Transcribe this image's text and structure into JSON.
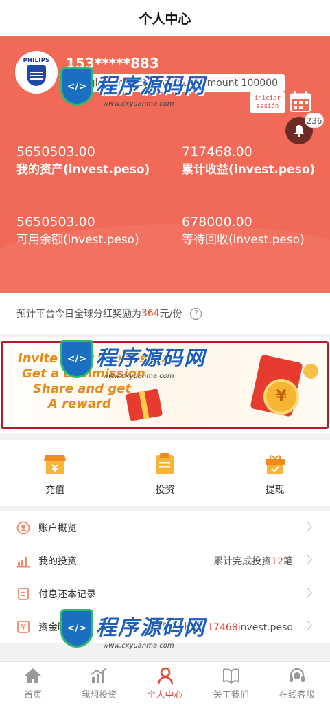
{
  "header": {
    "title": "个人中心"
  },
  "profile": {
    "avatar_brand": "PHILIPS",
    "username": "153*****883",
    "contract_text": "Single contract maximum amount 100000",
    "login_tag": "iniciar sesión",
    "notification_count": "236"
  },
  "stats": [
    {
      "value": "5650503.00",
      "label": "我的资产(invest.peso)"
    },
    {
      "value": "717468.00",
      "label": "累计收益(invest.peso)"
    },
    {
      "value": "5650503.00",
      "label": "可用余额(invest.peso)"
    },
    {
      "value": "678000.00",
      "label": "等待回收(invest.peso)"
    }
  ],
  "notice": {
    "prefix": "预计平台今日全球分红奖励为",
    "amount": "364",
    "suffix": "元/份",
    "help_icon": "?"
  },
  "banner": {
    "lines": [
      "Invite your friends to",
      "Get a commission",
      "Share and get",
      "A reward"
    ],
    "coin_symbol": "¥"
  },
  "actions": [
    {
      "label": "充值",
      "icon": "store-icon"
    },
    {
      "label": "投资",
      "icon": "clipboard-icon"
    },
    {
      "label": "提现",
      "icon": "gift-icon"
    }
  ],
  "menu": [
    {
      "label": "账户概览",
      "icon": "user-circle-icon",
      "right_prefix": "",
      "right_value": "",
      "right_suffix": ""
    },
    {
      "label": "我的投资",
      "icon": "bar-chart-icon",
      "right_prefix": "累计完成投资",
      "right_value": "12",
      "right_suffix": "笔"
    },
    {
      "label": "付息还本记录",
      "icon": "receipt-icon",
      "right_prefix": "",
      "right_value": "",
      "right_suffix": ""
    },
    {
      "label": "资金明细",
      "icon": "money-doc-icon",
      "right_prefix": "已赚取收益",
      "right_value": "717468",
      "right_suffix": "invest.peso"
    }
  ],
  "tabs": [
    {
      "label": "首页",
      "icon": "home-icon",
      "active": false
    },
    {
      "label": "我想投资",
      "icon": "chart-icon",
      "active": false
    },
    {
      "label": "个人中心",
      "icon": "person-icon",
      "active": true
    },
    {
      "label": "关于我们",
      "icon": "book-icon",
      "active": false
    },
    {
      "label": "在线客服",
      "icon": "headset-icon",
      "active": false
    }
  ],
  "watermark": {
    "text": "程序源码网",
    "url": "www.cxyuanma.com"
  },
  "colors": {
    "primary": "#f16a57",
    "highlight": "#e3412f",
    "banner_border": "#b8182a"
  }
}
